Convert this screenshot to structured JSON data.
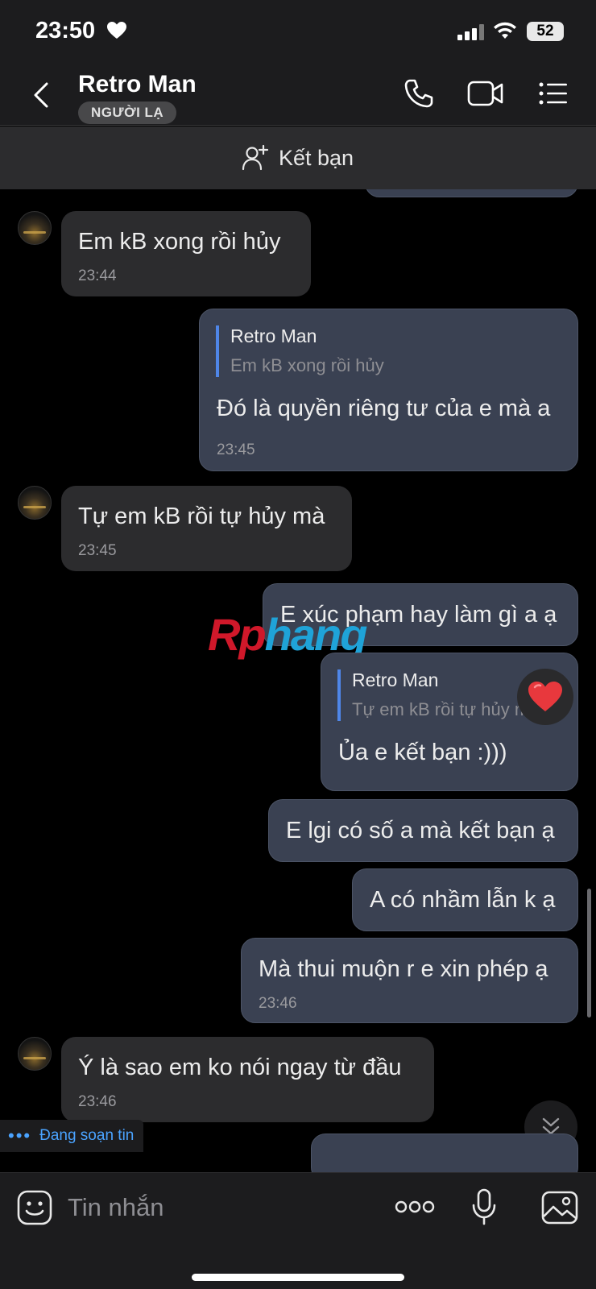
{
  "status_bar": {
    "time": "23:50",
    "battery": "52"
  },
  "header": {
    "contact_name": "Retro Man",
    "badge": "NGƯỜI LẠ"
  },
  "friend_bar": {
    "label": "Kết bạn"
  },
  "messages": [
    {
      "direction": "in",
      "text": "Em kB xong rồi hủy",
      "time": "23:44"
    },
    {
      "direction": "out",
      "reply_to_name": "Retro Man",
      "reply_to_text": "Em kB xong rồi hủy",
      "text": "Đó là quyền riêng tư của e mà a",
      "time": "23:45"
    },
    {
      "direction": "in",
      "text": "Tự em kB rồi tự hủy mà",
      "time": "23:45"
    },
    {
      "direction": "out",
      "text": "E xúc phạm hay làm gì a ạ"
    },
    {
      "direction": "out",
      "reply_to_name": "Retro Man",
      "reply_to_text": "Tự em kB rồi tự hủy mà",
      "text": "Ủa e kết bạn :)))",
      "reaction": "heart"
    },
    {
      "direction": "out",
      "text": "E lgi có số a mà kết bạn ạ"
    },
    {
      "direction": "out",
      "text": "A có nhầm lẫn k ạ"
    },
    {
      "direction": "out",
      "text": "Mà thui muộn r e xin phép ạ",
      "time": "23:46"
    },
    {
      "direction": "in",
      "text": "Ý là sao em ko nói ngay từ đầu",
      "time": "23:46"
    }
  ],
  "watermark": {
    "part1": "Rp",
    "part2": "hang"
  },
  "typing_indicator": {
    "text": "Đang soạn tin"
  },
  "input_bar": {
    "placeholder": "Tin nhắn"
  },
  "colors": {
    "accent_blue": "#4f86e8",
    "outgoing_bubble": "#3a4152",
    "incoming_bubble": "#2c2c2e",
    "typing": "#4aa3ff"
  },
  "icons": [
    "heart-icon",
    "signal-icon",
    "wifi-icon",
    "back-icon",
    "phone-icon",
    "video-icon",
    "menu-icon",
    "add-friend-icon",
    "heart-reaction-icon",
    "chevrons-down-icon",
    "sticker-icon",
    "more-icon",
    "mic-icon",
    "image-icon"
  ]
}
